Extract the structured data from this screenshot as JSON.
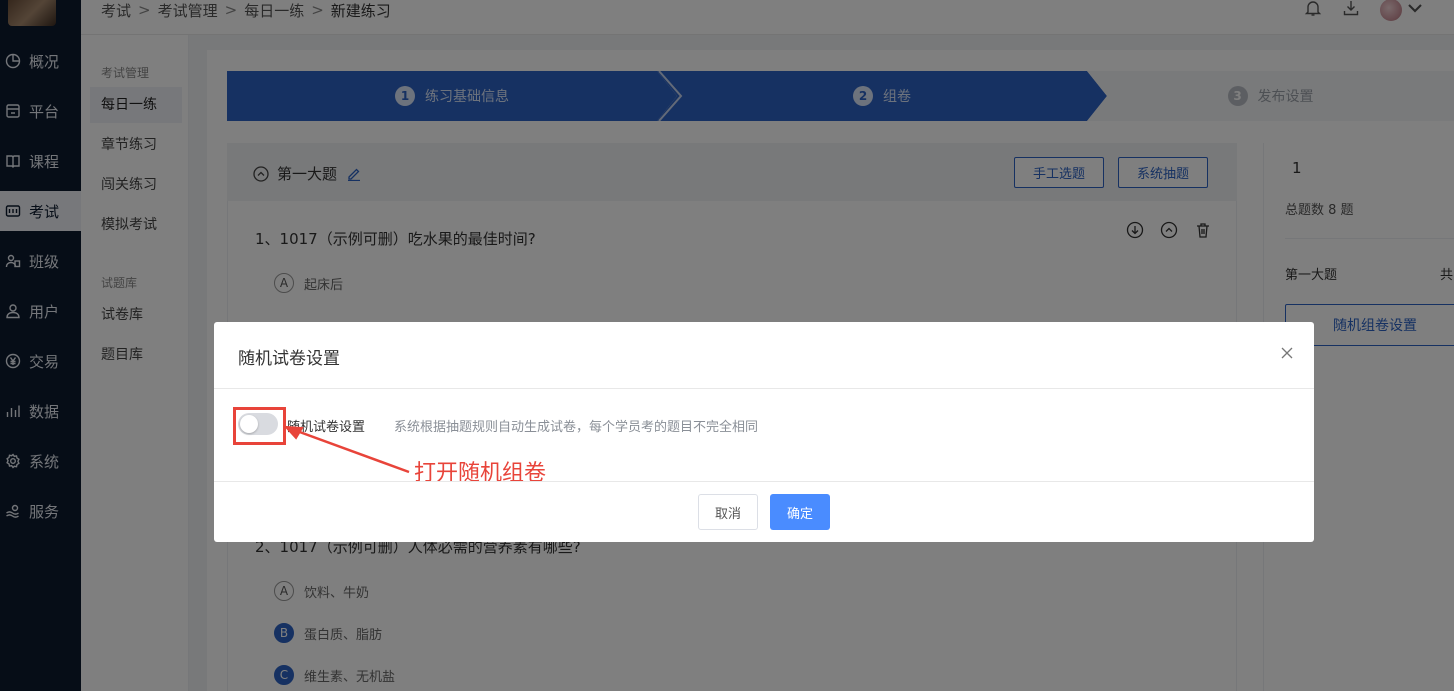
{
  "nav": {
    "items": [
      {
        "label": "概况",
        "icon": "pie-chart-icon"
      },
      {
        "label": "平台",
        "icon": "storefront-icon"
      },
      {
        "label": "课程",
        "icon": "book-icon"
      },
      {
        "label": "考试",
        "icon": "exam-icon"
      },
      {
        "label": "班级",
        "icon": "users-icon"
      },
      {
        "label": "用户",
        "icon": "user-icon"
      },
      {
        "label": "交易",
        "icon": "yen-icon"
      },
      {
        "label": "数据",
        "icon": "bar-chart-icon"
      },
      {
        "label": "系统",
        "icon": "gear-icon"
      },
      {
        "label": "服务",
        "icon": "service-icon"
      }
    ],
    "active_index": 3
  },
  "breadcrumb": [
    "考试",
    "考试管理",
    "每日一练",
    "新建练习"
  ],
  "submenu": {
    "group1": "考试管理",
    "group1_items": [
      "每日一练",
      "章节练习",
      "闯关练习",
      "模拟考试"
    ],
    "group2": "试题库",
    "group2_items": [
      "试卷库",
      "题目库"
    ]
  },
  "steps": [
    {
      "num": "1",
      "label": "练习基础信息"
    },
    {
      "num": "2",
      "label": "组卷"
    },
    {
      "num": "3",
      "label": "发布设置"
    }
  ],
  "section": {
    "title": "第一大题",
    "manual_button": "手工选题",
    "system_button": "系统抽题"
  },
  "questions": [
    {
      "title": "1、1017（示例可删）吃水果的最佳时间?",
      "options": [
        {
          "letter": "A",
          "text": "起床后",
          "selected": false
        }
      ]
    },
    {
      "title": "2、1017（示例可删）人体必需的营养素有哪些?",
      "options": [
        {
          "letter": "A",
          "text": "饮料、牛奶",
          "selected": false
        },
        {
          "letter": "B",
          "text": "蛋白质、脂肪",
          "selected": true
        },
        {
          "letter": "C",
          "text": "维生素、无机盐",
          "selected": true
        }
      ]
    }
  ],
  "right_panel": {
    "number": "1",
    "total": "总题数 8 题",
    "section_name": "第一大题",
    "section_suffix": "共",
    "button": "随机组卷设置"
  },
  "modal": {
    "title": "随机试卷设置",
    "toggle_label": "随机试卷设置",
    "toggle_on": false,
    "description": "系统根据抽题规则自动生成试卷，每个学员考的题目不完全相同",
    "annotation": "打开随机组卷",
    "cancel": "取消",
    "confirm": "确定"
  },
  "colors": {
    "nav_bg": "#0d1a2e",
    "primary": "#2d63c4",
    "confirm": "#4a8cff",
    "annotation": "#e8443a"
  }
}
